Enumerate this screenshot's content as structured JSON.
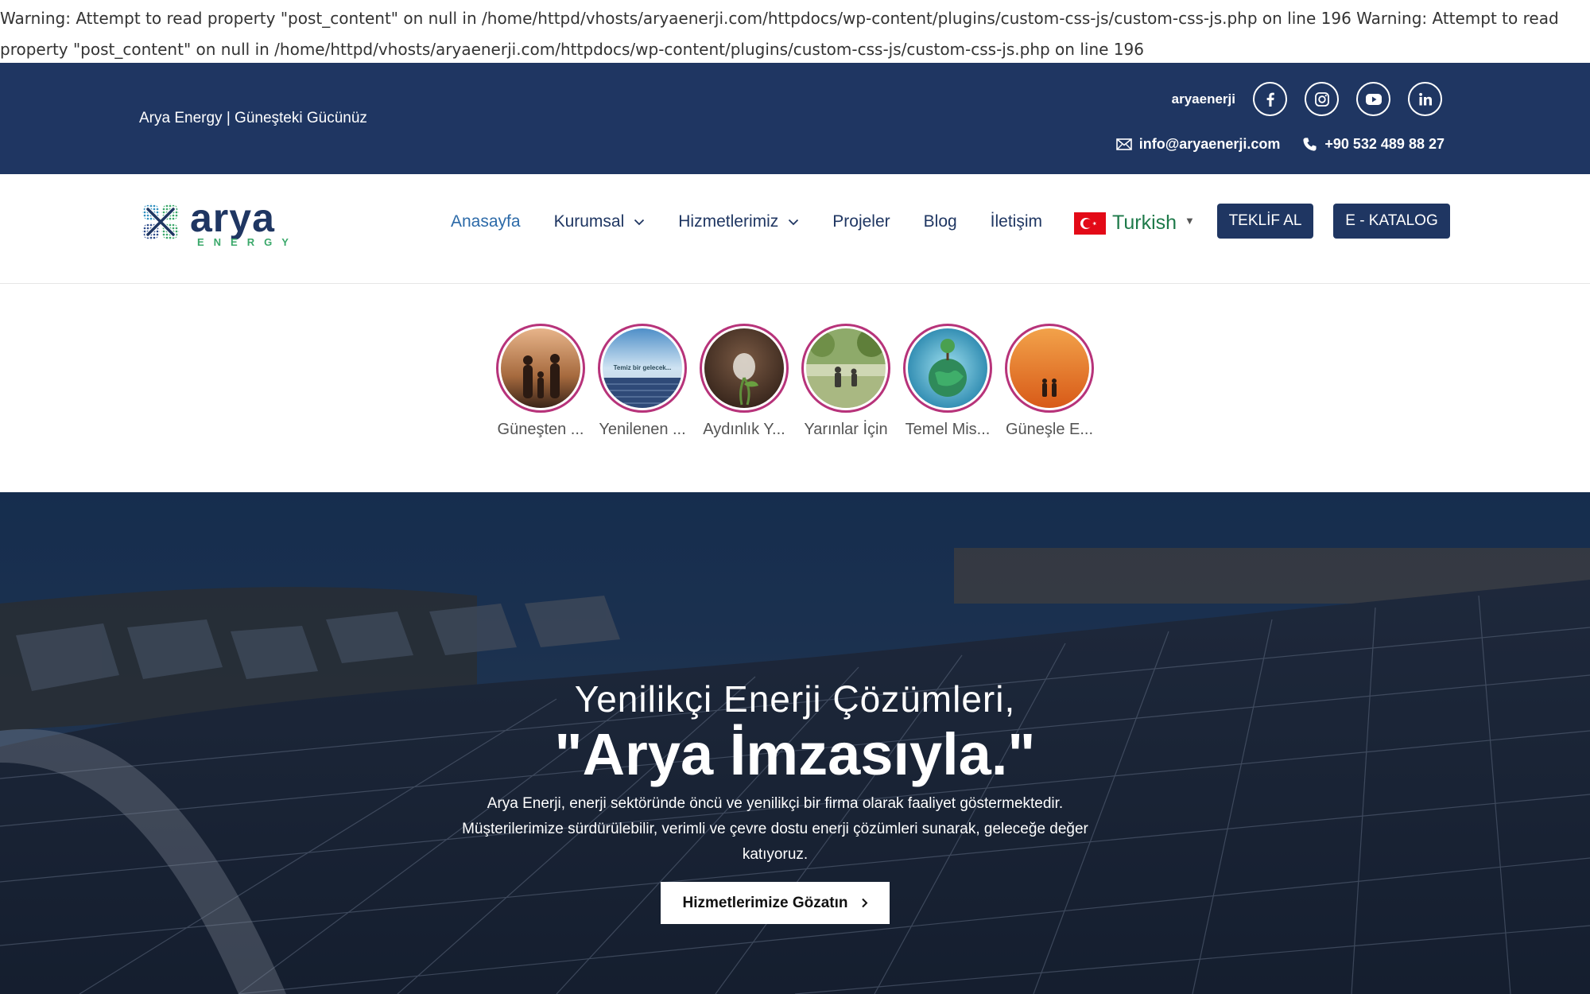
{
  "warning_text": "Warning: Attempt to read property \"post_content\" on null in /home/httpd/vhosts/aryaenerji.com/httpdocs/wp-content/plugins/custom-css-js/custom-css-js.php on line 196 Warning: Attempt to read property \"post_content\" on null in /home/httpd/vhosts/aryaenerji.com/httpdocs/wp-content/plugins/custom-css-js/custom-css-js.php on line 196",
  "topbar": {
    "tagline": "Arya Energy | Güneşteki Gücünüz",
    "handle": "aryaenerji",
    "social_icons": [
      "facebook-icon",
      "instagram-icon",
      "youtube-icon",
      "linkedin-icon"
    ],
    "email": "info@aryaenerji.com",
    "phone": "+90 532 489 88 27",
    "bg_color": "#1f3662"
  },
  "logo": {
    "word": "arya",
    "sub": "ENERGY"
  },
  "nav": {
    "items": [
      {
        "label": "Anasayfa",
        "active": true
      },
      {
        "label": "Kurumsal",
        "has_dropdown": true
      },
      {
        "label": "Hizmetlerimiz",
        "has_dropdown": true
      },
      {
        "label": "Projeler"
      },
      {
        "label": "Blog"
      },
      {
        "label": "İletişim"
      }
    ],
    "language": "Turkish",
    "quote_button": "TEKLİF AL",
    "catalog_button": "E - KATALOG",
    "accent_color": "#2c6aa8"
  },
  "stories": [
    {
      "caption": "Güneşten ..."
    },
    {
      "caption": "Yenilenen ...",
      "image_text": "Temiz bir gelecek..."
    },
    {
      "caption": "Aydınlık Y..."
    },
    {
      "caption": "Yarınlar İçin"
    },
    {
      "caption": "Temel Mis..."
    },
    {
      "caption": "Güneşle E..."
    }
  ],
  "hero": {
    "subtitle": "Yenilikçi Enerji Çözümleri,",
    "title": "\"Arya İmzasıyla.\"",
    "description": "Arya Enerji, enerji sektöründe öncü ve yenilikçi bir firma olarak faaliyet göstermektedir. Müşterilerimize sürdürülebilir, verimli ve çevre dostu enerji çözümleri sunarak, geleceğe değer katıyoruz.",
    "cta": "Hizmetlerimize Gözatın"
  }
}
